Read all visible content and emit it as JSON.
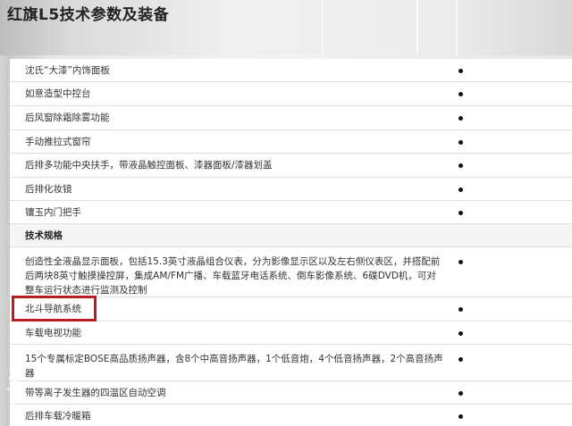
{
  "page": {
    "title": "红旗L5技术参数及装备"
  },
  "rows": [
    {
      "label": "沈氏“大漆”内饰面板",
      "mark": "•"
    },
    {
      "label": "如意造型中控台",
      "mark": "•"
    },
    {
      "label": "后风窗除霜除雾功能",
      "mark": "•"
    },
    {
      "label": "手动推拉式窗帘",
      "mark": "•"
    },
    {
      "label": "后排多功能中央扶手，带液晶触控面板、漆器面板/漆器划盖",
      "mark": "•"
    },
    {
      "label": "后排化妆镜",
      "mark": "•"
    },
    {
      "label": "镶玉内门把手",
      "mark": "•"
    },
    {
      "label": "技术规格",
      "mark": ""
    },
    {
      "label": "创造性全液晶显示面板，包括15.3英寸液晶组合仪表，分为影像显示区以及左右侧仪表区，并搭配前后两块8英寸触摸操控屏，集成AM/FM广播、车载蓝牙电话系统、倒车影像系统、6碟DVD机，可对整车运行状态进行监测及控制",
      "mark": "•"
    },
    {
      "label": "北斗导航系统",
      "mark": "•"
    },
    {
      "label": "车载电视功能",
      "mark": "•"
    },
    {
      "label": "15个专属标定BOSE高品质扬声器，含8个中高音扬声器，1个低音炮，4个低音扬声器，2个高音扬声器",
      "mark": "•"
    },
    {
      "label": "带等离子发生器的四温区自动空调",
      "mark": "•"
    },
    {
      "label": "后排车载冷暖箱",
      "mark": "•"
    }
  ],
  "colors": {
    "highlight": "#b51e22",
    "dot": "#111111"
  }
}
